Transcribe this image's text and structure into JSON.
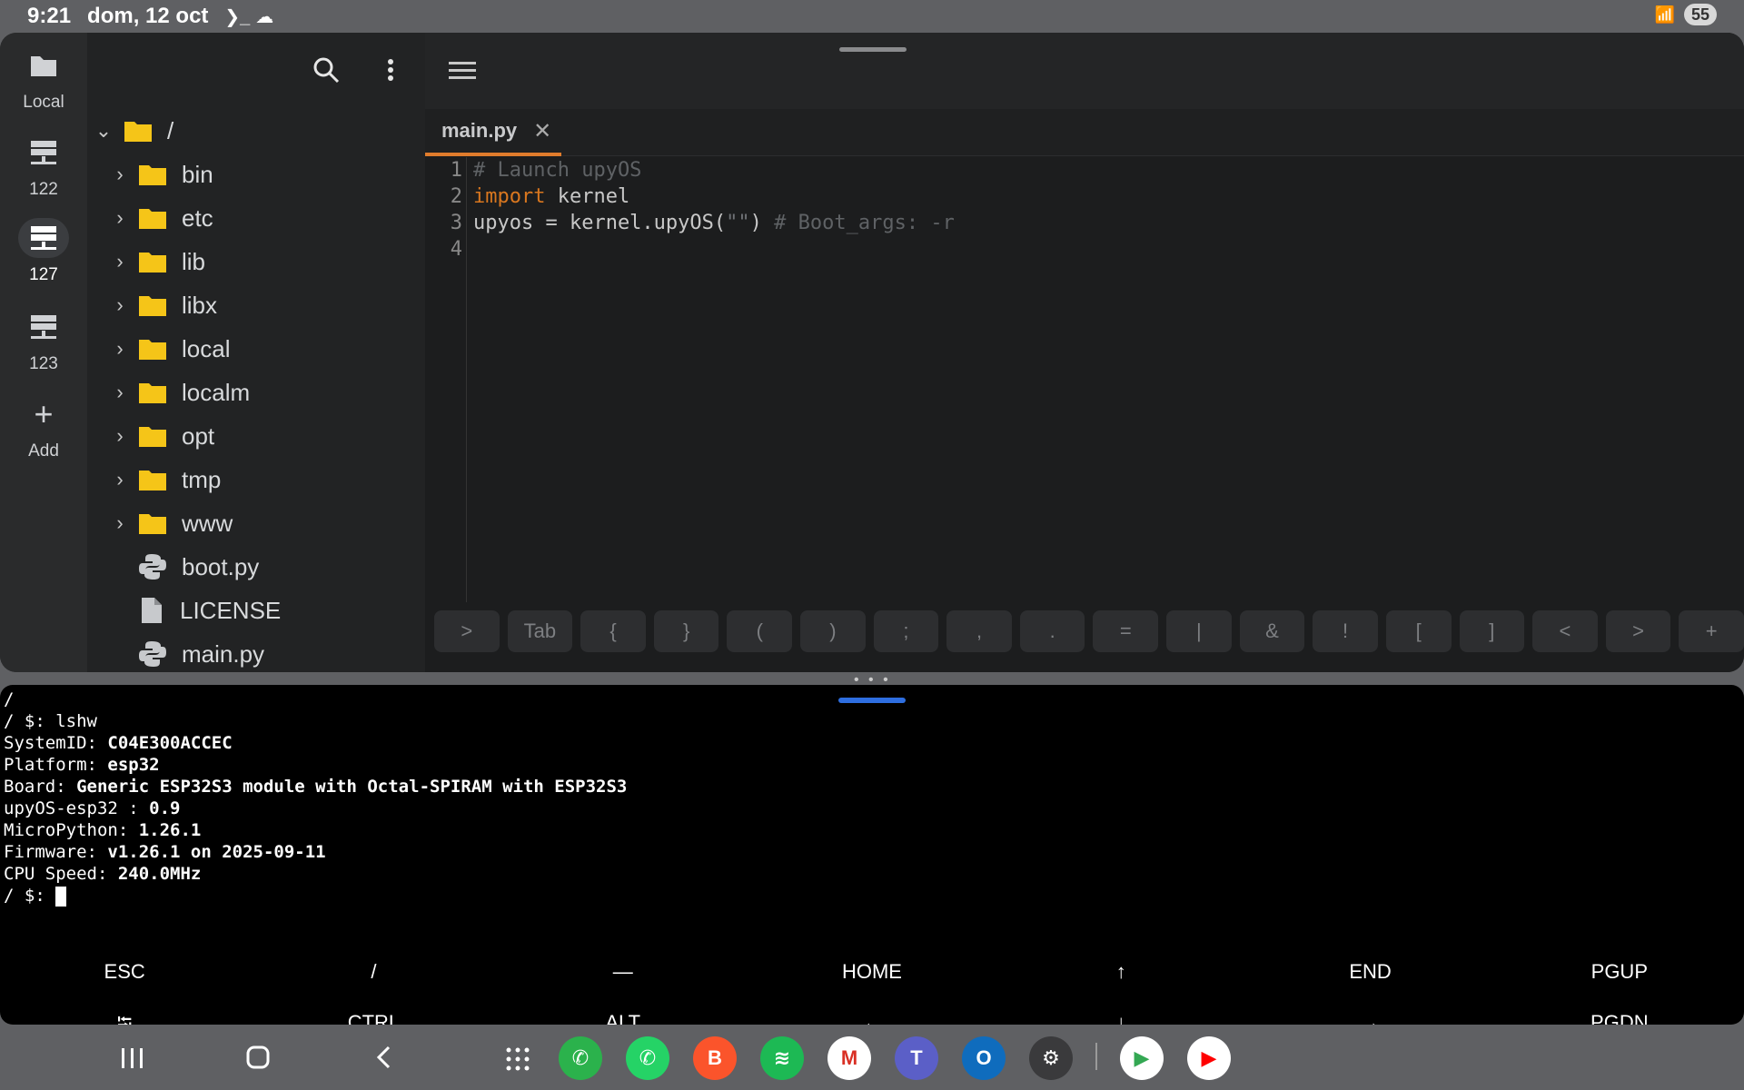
{
  "status": {
    "time": "9:21",
    "date": "dom, 12 oct",
    "battery": "55"
  },
  "rail": [
    {
      "label": "Local",
      "icon": "folder-icon"
    },
    {
      "label": "122",
      "icon": "server-icon"
    },
    {
      "label": "127",
      "icon": "server-icon"
    },
    {
      "label": "123",
      "icon": "server-icon"
    },
    {
      "label": "Add",
      "icon": "plus-icon"
    }
  ],
  "tree": {
    "root": "/",
    "items": [
      {
        "name": "bin",
        "type": "folder"
      },
      {
        "name": "etc",
        "type": "folder"
      },
      {
        "name": "lib",
        "type": "folder"
      },
      {
        "name": "libx",
        "type": "folder"
      },
      {
        "name": "local",
        "type": "folder"
      },
      {
        "name": "localm",
        "type": "folder"
      },
      {
        "name": "opt",
        "type": "folder"
      },
      {
        "name": "tmp",
        "type": "folder"
      },
      {
        "name": "www",
        "type": "folder"
      },
      {
        "name": "boot.py",
        "type": "python"
      },
      {
        "name": "LICENSE",
        "type": "file"
      },
      {
        "name": "main.py",
        "type": "python"
      }
    ]
  },
  "editor": {
    "tab": "main.py",
    "line_numbers": [
      "1",
      "2",
      "3",
      "4"
    ],
    "lines": [
      [
        {
          "t": "# Launch upyOS",
          "c": "com"
        }
      ],
      [
        {
          "t": "import",
          "c": "kw"
        },
        {
          "t": " kernel",
          "c": "txt"
        }
      ],
      [
        {
          "t": "upyos = kernel.upyOS(",
          "c": "txt"
        },
        {
          "t": "\"\"",
          "c": "str"
        },
        {
          "t": ") ",
          "c": "txt"
        },
        {
          "t": "# Boot_args: -r",
          "c": "com"
        }
      ],
      []
    ],
    "keys": [
      ">",
      "Tab",
      "{",
      "}",
      "(",
      ")",
      ";",
      ",",
      ".",
      "=",
      "|",
      "&",
      "!",
      "[",
      "]",
      "<",
      ">",
      "+"
    ]
  },
  "terminal": {
    "lines": [
      [
        {
          "t": "/"
        }
      ],
      [
        {
          "t": "/ $: lshw"
        }
      ],
      [
        {
          "t": "SystemID: "
        },
        {
          "t": "C04E300ACCEC",
          "b": true
        }
      ],
      [
        {
          "t": "Platform: "
        },
        {
          "t": "esp32",
          "b": true
        }
      ],
      [
        {
          "t": "Board: "
        },
        {
          "t": "Generic ESP32S3 module with Octal-SPIRAM with ESP32S3",
          "b": true
        }
      ],
      [
        {
          "t": "upyOS-esp32 : "
        },
        {
          "t": "0.9",
          "b": true
        }
      ],
      [
        {
          "t": "MicroPython: "
        },
        {
          "t": "1.26.1",
          "b": true
        }
      ],
      [
        {
          "t": "Firmware: "
        },
        {
          "t": "v1.26.1 on 2025-09-11",
          "b": true
        }
      ],
      [
        {
          "t": "CPU Speed: "
        },
        {
          "t": "240.0MHz",
          "b": true
        }
      ],
      [
        {
          "t": "/ $: "
        }
      ]
    ],
    "keys_row1": [
      "ESC",
      "/",
      "—",
      "HOME",
      "↑",
      "END",
      "PGUP"
    ],
    "keys_row2": [
      "⭾",
      "CTRL",
      "ALT",
      "←",
      "↓",
      "→",
      "PGDN"
    ]
  },
  "dock": [
    {
      "name": "phone-app",
      "color": "#2bb24c",
      "glyph": "✆"
    },
    {
      "name": "whatsapp-app",
      "color": "#25d366",
      "glyph": "✆"
    },
    {
      "name": "brave-app",
      "color": "#fb542b",
      "glyph": "B"
    },
    {
      "name": "spotify-app",
      "color": "#1db954",
      "glyph": "≋"
    },
    {
      "name": "gmail-app",
      "color": "#ffffff",
      "glyph": "M"
    },
    {
      "name": "teams-app",
      "color": "#5b5fc7",
      "glyph": "T"
    },
    {
      "name": "outlook-app",
      "color": "#0f6cbd",
      "glyph": "O"
    },
    {
      "name": "settings-app",
      "color": "#3a3a3c",
      "glyph": "⚙"
    },
    {
      "name": "play-store-app",
      "color": "#ffffff",
      "glyph": "▶"
    },
    {
      "name": "youtube-app",
      "color": "#ffffff",
      "glyph": "▶"
    }
  ]
}
